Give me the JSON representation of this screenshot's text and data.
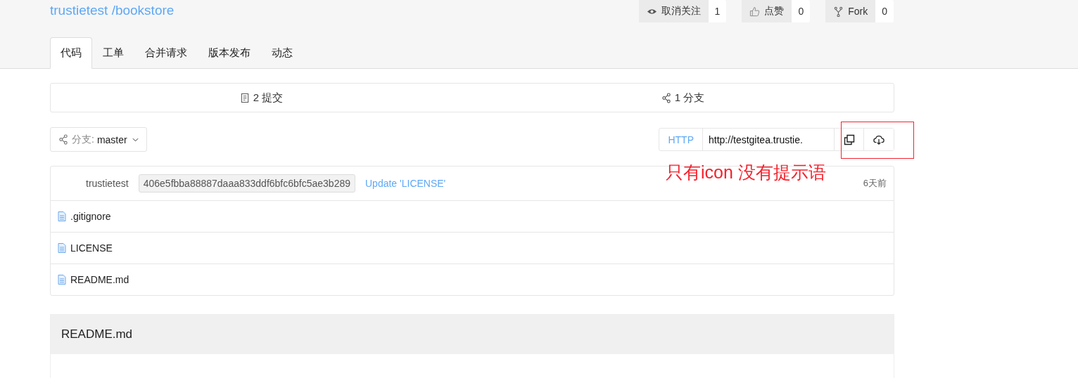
{
  "repo": {
    "owner": "trustietest",
    "name": "/bookstore"
  },
  "actions": [
    {
      "kind": "watch",
      "label": "取消关注",
      "count": "1"
    },
    {
      "kind": "like",
      "label": "点赞",
      "count": "0"
    },
    {
      "kind": "fork",
      "label": "Fork",
      "count": "0"
    }
  ],
  "tabs": [
    {
      "label": "代码",
      "selected": true
    },
    {
      "label": "工单",
      "selected": false
    },
    {
      "label": "合并请求",
      "selected": false
    },
    {
      "label": "版本发布",
      "selected": false
    },
    {
      "label": "动态",
      "selected": false
    }
  ],
  "stats": [
    {
      "kind": "commits",
      "count": "2",
      "label": "提交"
    },
    {
      "kind": "branches",
      "count": "1",
      "label": "分支"
    }
  ],
  "branch": {
    "label": "分支:",
    "value": "master"
  },
  "clone": {
    "protocol": "HTTP",
    "url": "http://testgitea.trustie."
  },
  "last_commit": {
    "author": "trustietest",
    "sha": "406e5fbba88887daaa833ddf6bfc6bfc5ae3b289",
    "message": "Update 'LICENSE'",
    "time": "6天前"
  },
  "files": [
    {
      "name": ".gitignore"
    },
    {
      "name": "LICENSE"
    },
    {
      "name": "README.md"
    }
  ],
  "readme": {
    "title": "README.md"
  },
  "annotation": {
    "text": "只有icon 没有提示语"
  }
}
